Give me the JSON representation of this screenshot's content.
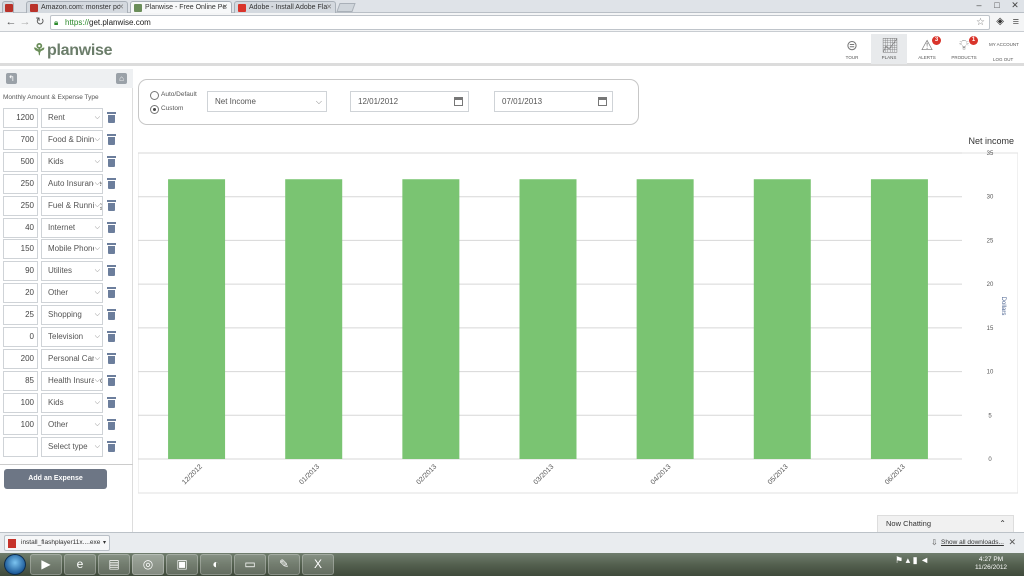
{
  "browser": {
    "tabs": [
      {
        "title": "Amazon.com: monster pc",
        "icon_color": "#b9322a"
      },
      {
        "title": "Planwise - Free Online Pe",
        "icon_color": "#6b8e5a",
        "active": true
      },
      {
        "title": "Adobe - Install Adobe Fla",
        "icon_color": "#d9342b"
      }
    ],
    "url_scheme": "https://",
    "url_rest": "get.planwise.com"
  },
  "app": {
    "logo": "planwise",
    "nav": [
      {
        "label": "TOUR",
        "icon": "steering-icon"
      },
      {
        "label": "PLANS",
        "icon": "line-chart-icon",
        "active": true
      },
      {
        "label": "ALERTS",
        "icon": "warning-icon",
        "badge": "3"
      },
      {
        "label": "PRODUCTS",
        "icon": "lightbulb-icon",
        "badge": "1"
      }
    ],
    "my_account": "MY ACCOUNT",
    "log_out": "LOG OUT"
  },
  "sidebar": {
    "title": "Monthly Amount & Expense Type",
    "rows": [
      {
        "amount": "1200",
        "category": "Rent"
      },
      {
        "amount": "700",
        "category": "Food & Dining"
      },
      {
        "amount": "500",
        "category": "Kids"
      },
      {
        "amount": "250",
        "category": "Auto Insurance"
      },
      {
        "amount": "250",
        "category": "Fuel & Running"
      },
      {
        "amount": "40",
        "category": "Internet"
      },
      {
        "amount": "150",
        "category": "Mobile Phone"
      },
      {
        "amount": "90",
        "category": "Utilites"
      },
      {
        "amount": "20",
        "category": "Other"
      },
      {
        "amount": "25",
        "category": "Shopping"
      },
      {
        "amount": "0",
        "category": "Television"
      },
      {
        "amount": "200",
        "category": "Personal Care"
      },
      {
        "amount": "85",
        "category": "Health Insurance"
      },
      {
        "amount": "100",
        "category": "Kids"
      },
      {
        "amount": "100",
        "category": "Other"
      },
      {
        "amount": "",
        "category": "Select type"
      }
    ],
    "add_button": "Add an Expense"
  },
  "filters": {
    "auto_label": "Auto/Default",
    "custom_label": "Custom",
    "selected_mode": "custom",
    "metric": "Net Income",
    "start_date": "12/01/2012",
    "end_date": "07/01/2013"
  },
  "chart_data": {
    "type": "bar",
    "title": "Net income",
    "ylabel": "Dollars",
    "xlabel": "",
    "categories": [
      "12/2012",
      "01/2013",
      "02/2013",
      "03/2013",
      "04/2013",
      "05/2013",
      "06/2013"
    ],
    "values": [
      32,
      32,
      32,
      32,
      32,
      32,
      32
    ],
    "ylim": [
      0,
      35
    ],
    "yticks": [
      0,
      5,
      10,
      15,
      20,
      25,
      30,
      35
    ],
    "y_axis_side": "right",
    "grid": true,
    "bar_color": "#7ac472"
  },
  "chat": {
    "label": "Now Chatting"
  },
  "downloads": {
    "file": "install_flashplayer11x....exe",
    "show_all": "Show all downloads..."
  },
  "taskbar": {
    "time": "4:27 PM",
    "date": "11/26/2012"
  }
}
